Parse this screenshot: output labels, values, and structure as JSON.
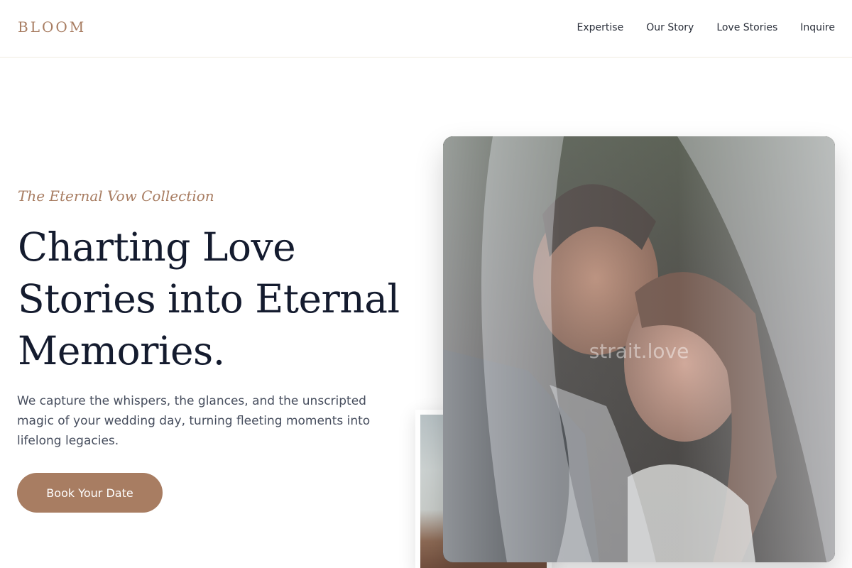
{
  "header": {
    "logo": "BLOOM",
    "nav": [
      "Expertise",
      "Our Story",
      "Love Stories",
      "Inquire"
    ]
  },
  "hero": {
    "eyebrow": "The Eternal Vow Collection",
    "headline_lines": [
      "Charting Love",
      "Stories into Eternal",
      "Memories."
    ],
    "lede": "We capture the whispers, the glances, and the unscripted magic of your wedding day, turning fleeting moments into lifelong legacies.",
    "cta_label": "Book Your Date"
  },
  "photo": {
    "watermark": "strait.love"
  },
  "colors": {
    "accent": "#a87d62",
    "heading": "#141b2e",
    "body_text": "#474e5e",
    "nav_text": "#2a2f3a"
  }
}
